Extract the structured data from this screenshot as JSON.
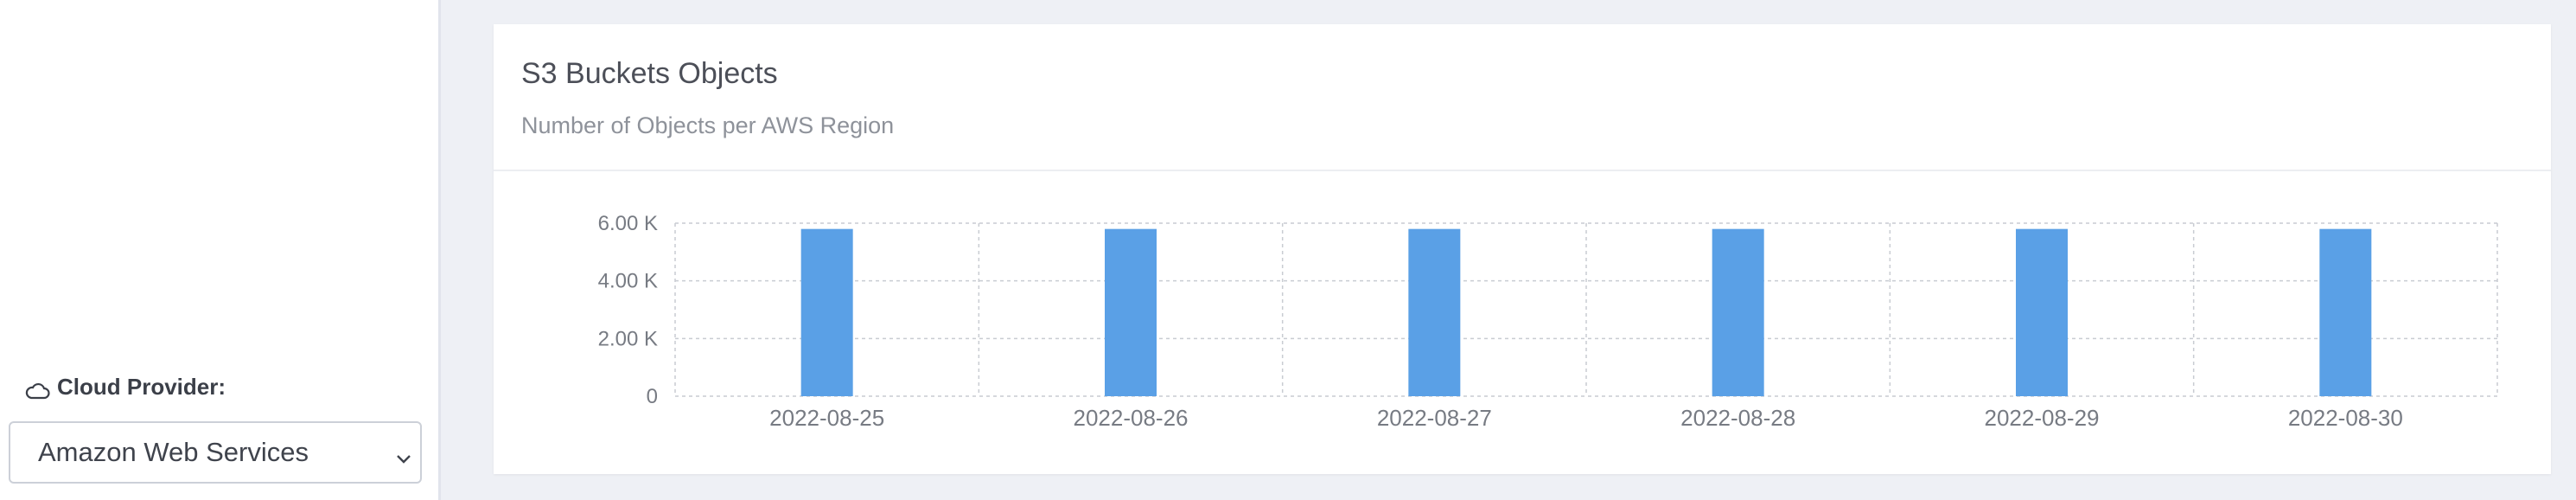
{
  "sidebar": {
    "provider_label": "Cloud Provider:",
    "provider_icon": "cloud-icon",
    "provider_select_value": "Amazon Web Services"
  },
  "card": {
    "title": "S3 Buckets Objects",
    "subtitle": "Number of Objects per AWS Region"
  },
  "chart_data": {
    "type": "bar",
    "categories": [
      "2022-08-25",
      "2022-08-26",
      "2022-08-27",
      "2022-08-28",
      "2022-08-29",
      "2022-08-30"
    ],
    "values": [
      5800,
      5800,
      5800,
      5800,
      5800,
      5800
    ],
    "ylim": [
      0,
      6000
    ],
    "yticks": [
      {
        "value": 0,
        "label": "0"
      },
      {
        "value": 2000,
        "label": "2.00 K"
      },
      {
        "value": 4000,
        "label": "4.00 K"
      },
      {
        "value": 6000,
        "label": "6.00 K"
      }
    ],
    "grid": true,
    "bar_color": "#5aa0e6"
  }
}
